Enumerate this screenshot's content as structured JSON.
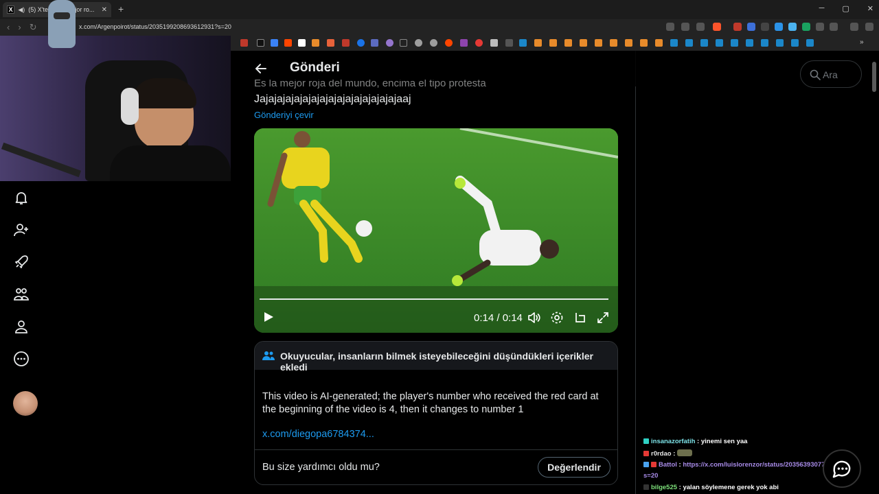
{
  "browser": {
    "tab_title": "(5) X'te P... la mejor ro...",
    "tab_favicon": "X",
    "tab_close": "✕",
    "new_tab": "+",
    "window_controls": [
      "─",
      "▢",
      "✕"
    ],
    "url": "x.com/Argenpoirot/status/2035199208693612931?s=20"
  },
  "header": {
    "title": "Gönderi"
  },
  "tweet": {
    "text_cut": "Es la mejor roja del mundo, encima el tipo protesta",
    "text": "Jajajajajajajajajajajajajajajajajaaj",
    "translate_link": "Gönderiyi çevir"
  },
  "video": {
    "time": "0:14 / 0:14",
    "progress": 1.0,
    "controls": [
      "play-icon",
      "volume-icon",
      "settings-icon",
      "popout-icon",
      "fullscreen-icon"
    ]
  },
  "community_note": {
    "title": "Okuyucular, insanların bilmek isteyebileceğini düşündükleri içerikler ekledi",
    "body": "This video is AI-generated; the player's number who received the red card at the beginning of the video is 4, then it changes to number 1",
    "link": "x.com/diegopa6784374...",
    "question": "Bu size yardımcı oldu mu?",
    "rate_button": "Değerlendir"
  },
  "search": {
    "placeholder": "Ara"
  },
  "sidebar": {
    "items": [
      "notifications",
      "follow",
      "grok",
      "communities",
      "profile",
      "more"
    ]
  },
  "chat": {
    "lines": [
      {
        "user": "insanazorfatih",
        "sep": " : ",
        "message": "yinemi sen yaa",
        "color": "#7de3e8"
      },
      {
        "user": "r0rdao",
        "sep": " : ",
        "message": "",
        "color": "#e8e8e8"
      },
      {
        "user": "Battol",
        "sep": " : ",
        "message": "https://x.com/luislorenzor/status/2035639307776426295?",
        "color": "#a88be8"
      },
      {
        "user": "",
        "sep": "",
        "message": "s=20",
        "color": "#a88be8"
      },
      {
        "user": "bilge525",
        "sep": " : ",
        "message": "yalan söylemene gerek yok abi",
        "color": "#7de07a"
      }
    ]
  },
  "colors": {
    "accent": "#1d9bf0",
    "background": "#000000",
    "text": "#e7e9ea",
    "border": "#2f3336"
  }
}
